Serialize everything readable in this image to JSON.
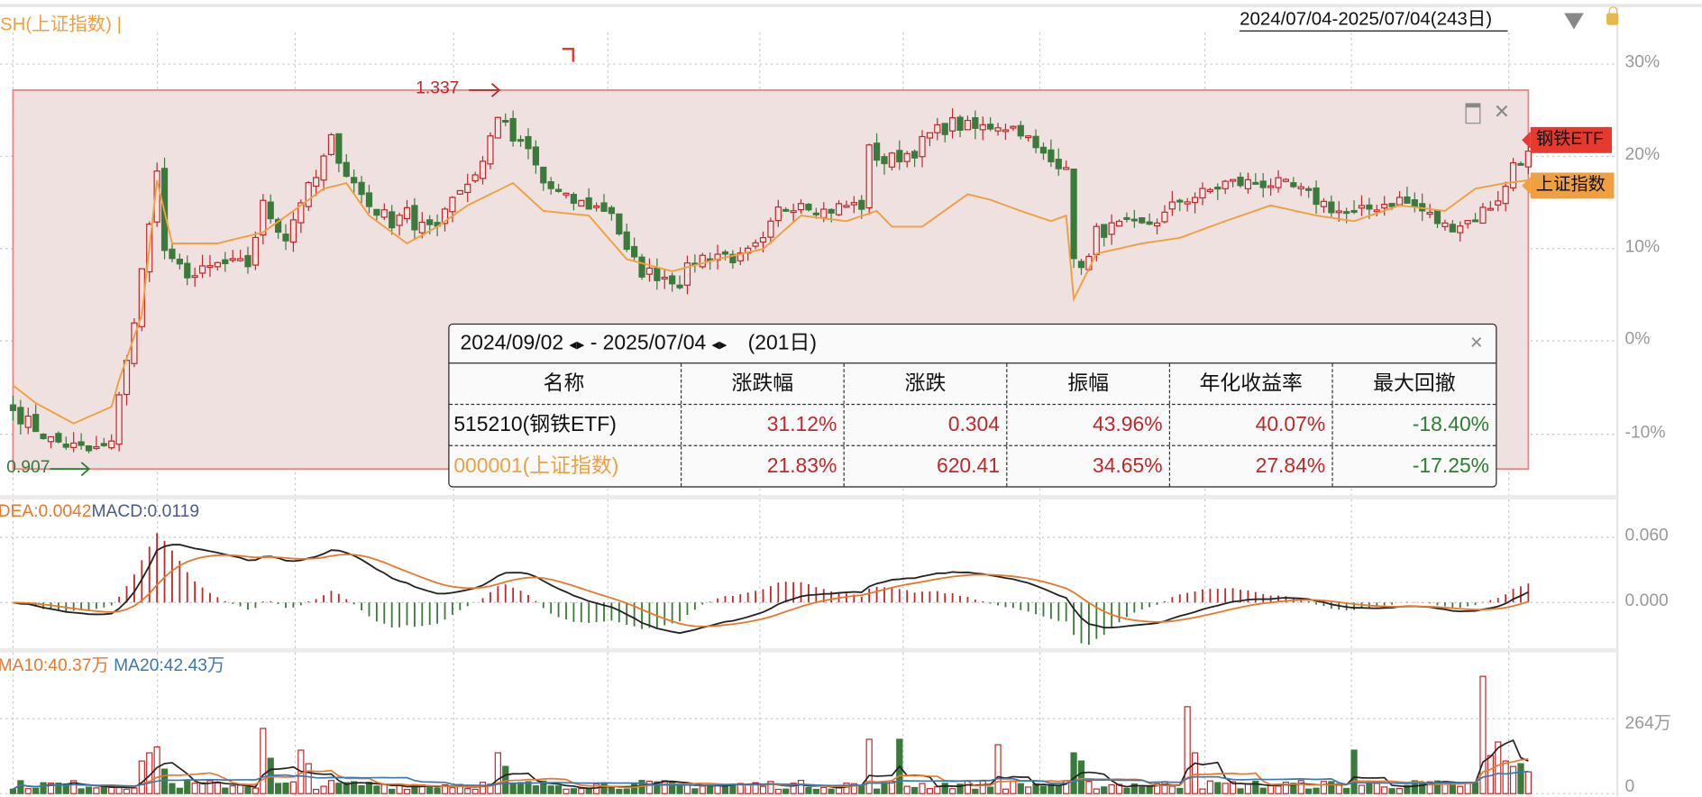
{
  "header": {
    "title": "SH(上证指数) |",
    "range_label": "2024/07/04-2025/07/04(243日)"
  },
  "colors": {
    "up": "#c0282a",
    "down": "#3a7a3a",
    "etf_tag": "#e8392e",
    "index": "#f0a040",
    "dif": "#222222",
    "dea": "#e8782a",
    "ma20": "#3a78b0",
    "region_fill": "#f0e0e0",
    "region_border": "#e88080"
  },
  "main_axis": {
    "ticks": [
      "30%",
      "20%",
      "10%",
      "0%",
      "-10%"
    ]
  },
  "legend_tags": {
    "etf": "钢铁ETF",
    "index": "上证指数"
  },
  "annotations": {
    "high": "1.337",
    "low": "0.907"
  },
  "stats_table": {
    "start_date": "2024/09/02",
    "end_date": "2025/07/04",
    "days": "(201日)",
    "nav_arrows": "◂▸",
    "separator": "-",
    "close": "×",
    "columns": [
      "名称",
      "涨跌幅",
      "涨跌",
      "振幅",
      "年化收益率",
      "最大回撤"
    ],
    "rows": [
      {
        "name": "515210(钢铁ETF)",
        "change_pct": "31.12%",
        "change": "0.304",
        "amplitude": "43.96%",
        "annualized": "40.07%",
        "max_drawdown": "-18.40%"
      },
      {
        "name": "000001(上证指数)",
        "change_pct": "21.83%",
        "change": "620.41",
        "amplitude": "34.65%",
        "annualized": "27.84%",
        "max_drawdown": "-17.25%"
      }
    ]
  },
  "macd": {
    "dea_label": "DEA:0.0042",
    "macd_label": "MACD:0.0119",
    "ticks": [
      "0.060",
      "0.000"
    ]
  },
  "volume": {
    "ma10_label": "MA10:40.37万",
    "ma20_label": "MA20:42.43万",
    "ticks": [
      "264万",
      "0"
    ]
  },
  "chart_data": {
    "type": "candlestick-comparison",
    "x_unit": "trading day index (0-200)",
    "y_unit": "% change",
    "ylim": [
      -13,
      30
    ],
    "base_price": 1.03,
    "etf_close_keypoints": [
      [
        0,
        -7.5
      ],
      [
        5,
        -10.7
      ],
      [
        10,
        -11.9
      ],
      [
        13,
        -11.3
      ],
      [
        14,
        -5.4
      ],
      [
        16,
        1.6
      ],
      [
        18,
        13.3
      ],
      [
        19,
        18
      ],
      [
        20,
        9.8
      ],
      [
        21,
        8.2
      ],
      [
        24,
        7.0
      ],
      [
        27,
        8.2
      ],
      [
        31,
        8.2
      ],
      [
        33,
        14.6
      ],
      [
        36,
        11.1
      ],
      [
        38,
        15.2
      ],
      [
        40,
        17.5
      ],
      [
        42,
        21.6
      ],
      [
        44,
        18.1
      ],
      [
        47,
        14.6
      ],
      [
        50,
        12.9
      ],
      [
        52,
        14.6
      ],
      [
        53,
        11.7
      ],
      [
        56,
        12.9
      ],
      [
        58,
        15.8
      ],
      [
        60,
        17.0
      ],
      [
        62,
        19.3
      ],
      [
        64,
        24.5
      ],
      [
        66,
        21.6
      ],
      [
        68,
        20.5
      ],
      [
        70,
        17.0
      ],
      [
        73,
        15.2
      ],
      [
        76,
        14.6
      ],
      [
        79,
        14.0
      ],
      [
        81,
        9.4
      ],
      [
        83,
        7.5
      ],
      [
        86,
        7.0
      ],
      [
        88,
        6.4
      ],
      [
        90,
        8.8
      ],
      [
        93,
        9.4
      ],
      [
        96,
        8.8
      ],
      [
        99,
        10.5
      ],
      [
        101,
        14.0
      ],
      [
        104,
        15.2
      ],
      [
        107,
        14.0
      ],
      [
        110,
        14.6
      ],
      [
        112,
        14.6
      ],
      [
        113,
        20.5
      ],
      [
        115,
        19.3
      ],
      [
        119,
        20.5
      ],
      [
        121,
        22.2
      ],
      [
        124,
        23.4
      ],
      [
        127,
        22.8
      ],
      [
        130,
        23.4
      ],
      [
        133,
        22.8
      ],
      [
        135,
        20.5
      ],
      [
        137,
        19.3
      ],
      [
        139,
        19.3
      ],
      [
        140,
        8.2
      ],
      [
        142,
        8.8
      ],
      [
        143,
        11.7
      ],
      [
        146,
        12.3
      ],
      [
        149,
        12.3
      ],
      [
        152,
        13.5
      ],
      [
        154,
        15.2
      ],
      [
        157,
        15.8
      ],
      [
        160,
        17.0
      ],
      [
        163,
        17.0
      ],
      [
        166,
        17.0
      ],
      [
        169,
        16.4
      ],
      [
        172,
        15.2
      ],
      [
        175,
        14.0
      ],
      [
        177,
        13.5
      ],
      [
        180,
        14.6
      ],
      [
        183,
        15.2
      ],
      [
        186,
        14.0
      ],
      [
        189,
        12.3
      ],
      [
        192,
        12.9
      ],
      [
        195,
        14.6
      ],
      [
        197,
        16.4
      ],
      [
        198,
        19.3
      ],
      [
        200,
        20.0
      ]
    ],
    "index_keypoints": [
      [
        0,
        -4.8
      ],
      [
        3,
        -6.7
      ],
      [
        8,
        -8.9
      ],
      [
        13,
        -7.1
      ],
      [
        14,
        -4.2
      ],
      [
        17,
        2.8
      ],
      [
        19,
        17.3
      ],
      [
        21,
        10.5
      ],
      [
        27,
        10.5
      ],
      [
        33,
        11.7
      ],
      [
        37,
        14.0
      ],
      [
        41,
        16.4
      ],
      [
        44,
        17.0
      ],
      [
        47,
        13.5
      ],
      [
        52,
        10.5
      ],
      [
        56,
        12.3
      ],
      [
        60,
        14.6
      ],
      [
        66,
        17.0
      ],
      [
        70,
        14.0
      ],
      [
        76,
        13.5
      ],
      [
        81,
        8.8
      ],
      [
        87,
        7.5
      ],
      [
        93,
        8.8
      ],
      [
        99,
        9.9
      ],
      [
        104,
        13.5
      ],
      [
        110,
        12.9
      ],
      [
        114,
        14.0
      ],
      [
        116,
        12.3
      ],
      [
        120,
        12.3
      ],
      [
        126,
        15.8
      ],
      [
        129,
        15.2
      ],
      [
        133,
        14.0
      ],
      [
        137,
        12.9
      ],
      [
        139,
        13.5
      ],
      [
        140,
        4.5
      ],
      [
        143,
        9.4
      ],
      [
        149,
        10.5
      ],
      [
        154,
        11.1
      ],
      [
        160,
        12.9
      ],
      [
        166,
        14.6
      ],
      [
        172,
        13.5
      ],
      [
        177,
        12.9
      ],
      [
        183,
        14.6
      ],
      [
        189,
        14.0
      ],
      [
        193,
        16.4
      ],
      [
        197,
        17.0
      ],
      [
        200,
        17.3
      ]
    ],
    "volume_baseline_wan": 38,
    "volume_spikes_wan": [
      [
        17,
        120
      ],
      [
        18,
        150
      ],
      [
        19,
        172
      ],
      [
        20,
        90
      ],
      [
        33,
        240
      ],
      [
        34,
        130
      ],
      [
        38,
        160
      ],
      [
        39,
        110
      ],
      [
        64,
        150
      ],
      [
        65,
        100
      ],
      [
        113,
        200
      ],
      [
        117,
        200
      ],
      [
        130,
        180
      ],
      [
        140,
        150
      ],
      [
        141,
        120
      ],
      [
        155,
        320
      ],
      [
        156,
        150
      ],
      [
        177,
        160
      ],
      [
        194,
        432
      ],
      [
        195,
        140
      ],
      [
        196,
        190
      ],
      [
        197,
        120
      ],
      [
        198,
        100
      ],
      [
        199,
        110
      ],
      [
        200,
        80
      ]
    ],
    "volume_ylim_wan": [
      0,
      460
    ],
    "macd_ylim": [
      -0.04,
      0.07
    ]
  }
}
